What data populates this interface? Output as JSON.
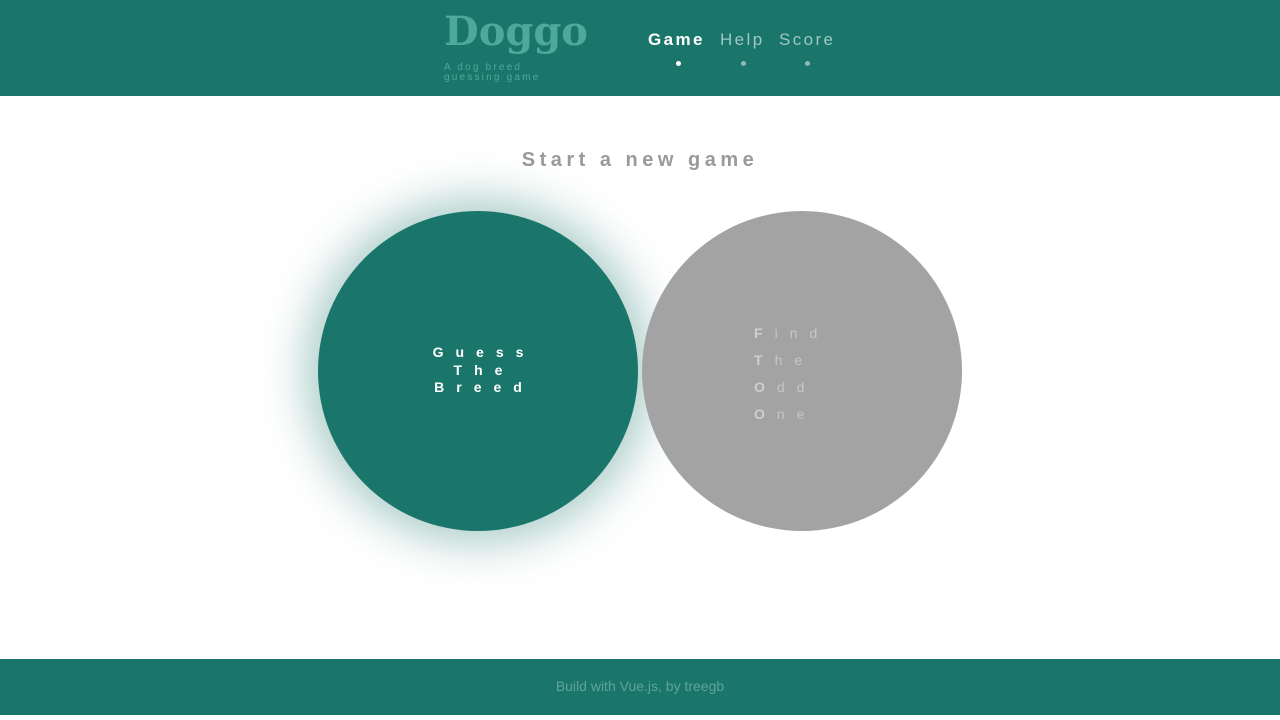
{
  "app": {
    "title": "Doggo",
    "subtitle": "A dog breed guessing game"
  },
  "nav": {
    "items": [
      {
        "label": "Game",
        "active": true
      },
      {
        "label": "Help",
        "active": false
      },
      {
        "label": "Score",
        "active": false
      }
    ]
  },
  "main": {
    "heading": "Start a new game",
    "modes": [
      {
        "lines": [
          "Guess",
          "The",
          "Breed"
        ],
        "selected": true
      },
      {
        "lines": [
          "Find",
          "The",
          "Odd",
          "One"
        ],
        "selected": false
      }
    ]
  },
  "footer": {
    "text": "Build with Vue.js, by treegb"
  },
  "colors": {
    "brand": "#1a766a",
    "inactive_mode": "#a3a3a3",
    "heading": "#9a9a9a"
  }
}
